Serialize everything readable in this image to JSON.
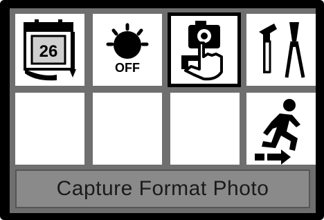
{
  "menu": {
    "items": [
      {
        "id": "date",
        "icon": "calendar-icon",
        "text": "26"
      },
      {
        "id": "flash-off",
        "icon": "flash-off-icon",
        "text": "OFF"
      },
      {
        "id": "capture-format",
        "icon": "camera-hand-icon",
        "text": "",
        "selected": true
      },
      {
        "id": "tools",
        "icon": "tools-icon",
        "text": ""
      },
      {
        "id": "empty-1",
        "icon": "",
        "text": ""
      },
      {
        "id": "empty-2",
        "icon": "",
        "text": ""
      },
      {
        "id": "empty-3",
        "icon": "",
        "text": ""
      },
      {
        "id": "exit",
        "icon": "exit-running-man-icon",
        "text": ""
      }
    ]
  },
  "status": {
    "label": "Capture Format Photo"
  }
}
